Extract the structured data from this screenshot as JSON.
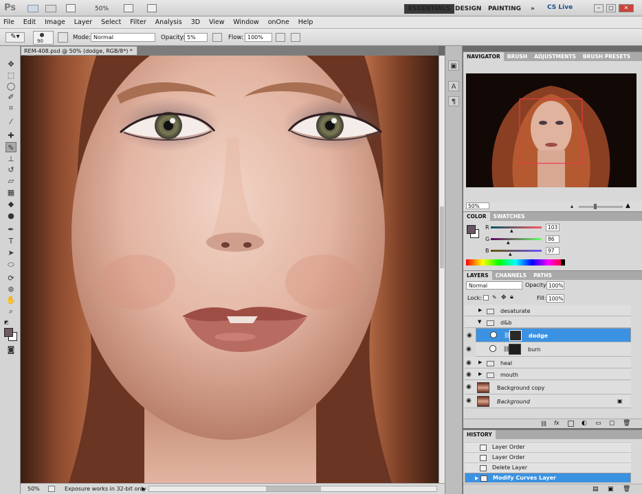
{
  "appbar": {
    "logo": "Ps",
    "zoom": "50%",
    "workspaces": [
      "ESSENTIALS",
      "DESIGN",
      "PAINTING"
    ],
    "more": "»",
    "cs_live": "CS Live"
  },
  "menu": [
    "File",
    "Edit",
    "Image",
    "Layer",
    "Select",
    "Filter",
    "Analysis",
    "3D",
    "View",
    "Window",
    "onOne",
    "Help"
  ],
  "options": {
    "brush_size": "90",
    "mode_label": "Mode:",
    "mode_value": "Normal",
    "opacity_label": "Opacity:",
    "opacity_value": "5%",
    "flow_label": "Flow:",
    "flow_value": "100%"
  },
  "document": {
    "tab_title": "REM-408.psd @ 50% (dodge, RGB/8*) *",
    "close": "×"
  },
  "status": {
    "zoom": "50%",
    "message": "Exposure works in 32-bit only"
  },
  "navigator": {
    "tabs": [
      "NAVIGATOR",
      "BRUSH",
      "ADJUSTMENTS",
      "BRUSH PRESETS"
    ],
    "zoom": "50%"
  },
  "color": {
    "tabs": [
      "COLOR",
      "SWATCHES"
    ],
    "r_label": "R",
    "g_label": "G",
    "b_label": "B",
    "r": "103",
    "g": "86",
    "b": "97",
    "r_level": 0.4,
    "g_level": 0.34,
    "b_level": 0.38
  },
  "layers": {
    "tabs": [
      "LAYERS",
      "CHANNELS",
      "PATHS"
    ],
    "blend_mode": "Normal",
    "opacity_label": "Opacity:",
    "opacity": "100%",
    "lock_label": "Lock:",
    "fill_label": "Fill:",
    "fill": "100%",
    "items": [
      {
        "name": "desaturate",
        "kind": "group",
        "visible": false
      },
      {
        "name": "d&b",
        "kind": "group-open",
        "visible": false
      },
      {
        "name": "dodge",
        "kind": "layer-mask",
        "visible": true,
        "selected": true
      },
      {
        "name": "burn",
        "kind": "layer-mask",
        "visible": true
      },
      {
        "name": "heal",
        "kind": "group",
        "visible": true
      },
      {
        "name": "mouth",
        "kind": "group",
        "visible": true
      },
      {
        "name": "Background copy",
        "kind": "photo",
        "visible": true
      },
      {
        "name": "Background",
        "kind": "photo-locked",
        "visible": true
      }
    ]
  },
  "history": {
    "tabs": [
      "HISTORY"
    ],
    "items": [
      "Layer Order",
      "Layer Order",
      "Delete Layer",
      "Modify Curves Layer"
    ]
  },
  "colors": {
    "selection": "#3b92e3",
    "panel": "#d8d8d8",
    "accent": "#c9443a"
  }
}
